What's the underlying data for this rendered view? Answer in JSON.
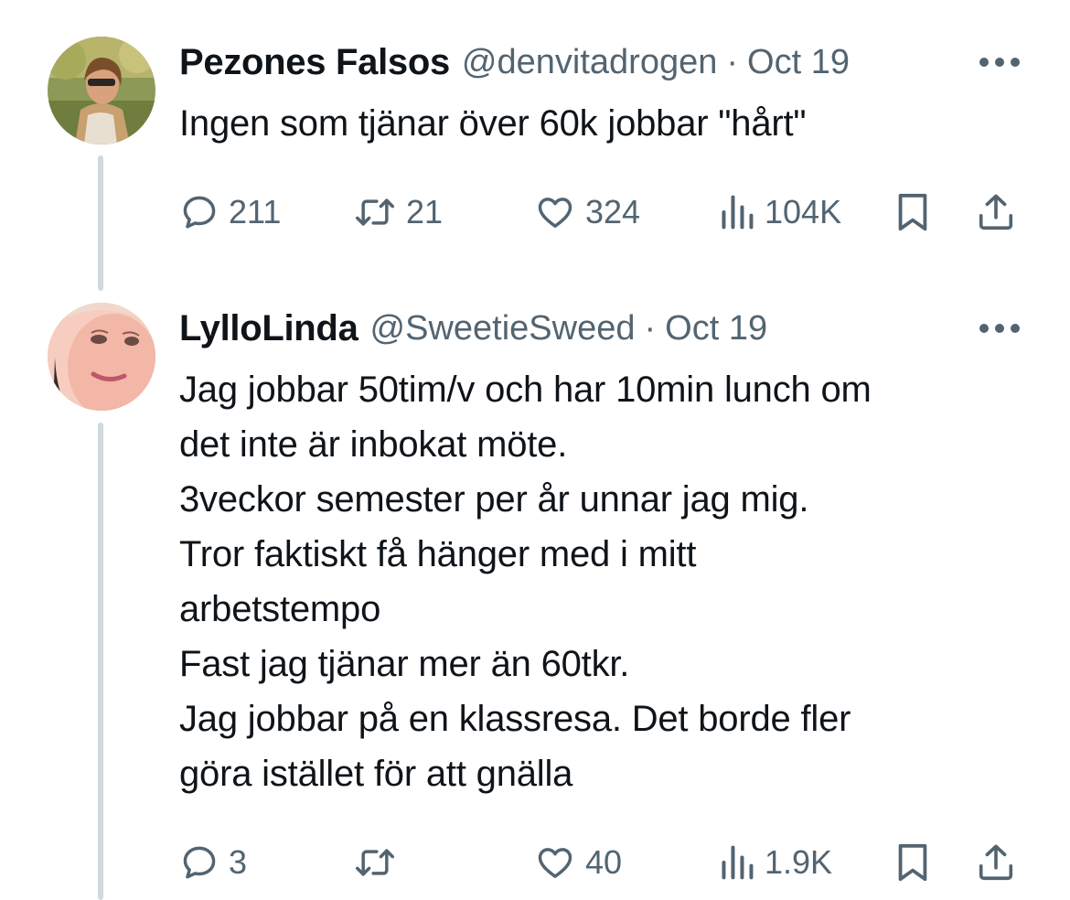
{
  "tweets": [
    {
      "display_name": "Pezones Falsos",
      "handle": "@denvitadrogen",
      "separator": "·",
      "date": "Oct 19",
      "text_lines": [
        "Ingen som tjänar över 60k jobbar \"hårt\""
      ],
      "stats": {
        "replies": "211",
        "retweets": "21",
        "likes": "324",
        "views": "104K"
      }
    },
    {
      "display_name": "LylloLinda",
      "handle": "@SweetieSweed",
      "separator": "·",
      "date": "Oct 19",
      "text_lines": [
        "Jag jobbar 50tim/v och har 10min lunch om",
        "det inte är inbokat möte.",
        "3veckor semester per år unnar jag mig.",
        "Tror faktiskt få hänger med i mitt",
        "arbetstempo",
        "Fast jag tjänar mer än 60tkr.",
        "Jag jobbar på en klassresa. Det borde fler",
        "göra istället för att gnälla"
      ],
      "stats": {
        "replies": "3",
        "retweets": "",
        "likes": "40",
        "views": "1.9K"
      }
    }
  ],
  "icons": {
    "more": "more-horizontal-icon",
    "reply": "reply-bubble-icon",
    "retweet": "retweet-arrows-icon",
    "like": "heart-icon",
    "views": "bar-chart-icon",
    "bookmark": "bookmark-icon",
    "share": "share-upload-icon"
  },
  "colors": {
    "text": "#0f1419",
    "secondary": "#536471",
    "thread_line": "#cfd9de",
    "background": "#ffffff"
  }
}
